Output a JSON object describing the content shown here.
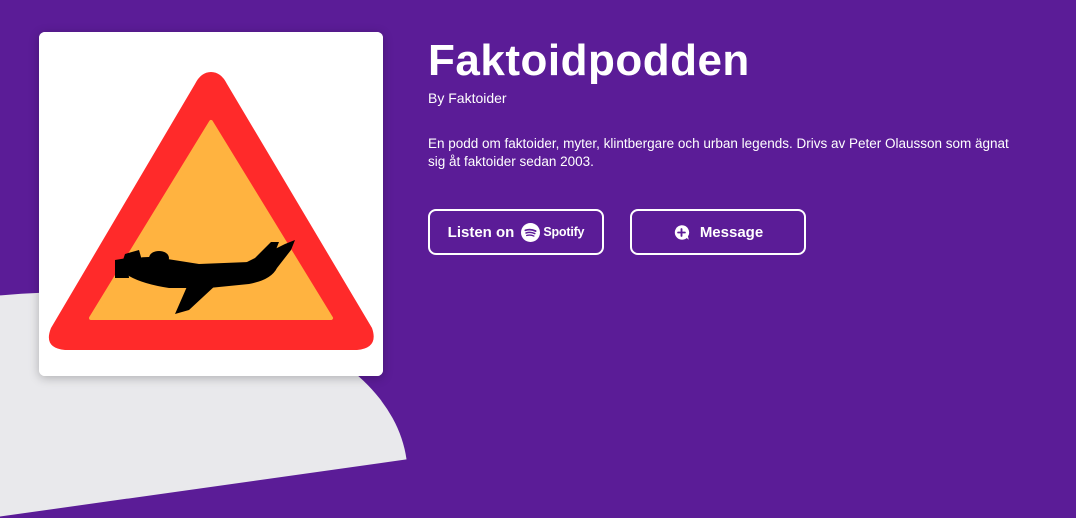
{
  "podcast": {
    "title": "Faktoidpodden",
    "author": "By Faktoider",
    "description": "En podd om faktoider, myter, klintbergare och urban legends. Drivs av Peter Olausson som ägnat sig åt faktoider sedan 2003."
  },
  "actions": {
    "listen_prefix": "Listen on",
    "spotify_wordmark": "Spotify",
    "message_label": "Message"
  },
  "colors": {
    "background": "#5b1c97",
    "sign_border": "#ff2a2a",
    "sign_fill": "#ffb340",
    "plane": "#000000",
    "curve": "#e9e9ec"
  },
  "icons": {
    "cover": "warning-sign-airplane-icon",
    "spotify": "spotify-logo-icon",
    "message": "message-plus-icon"
  }
}
